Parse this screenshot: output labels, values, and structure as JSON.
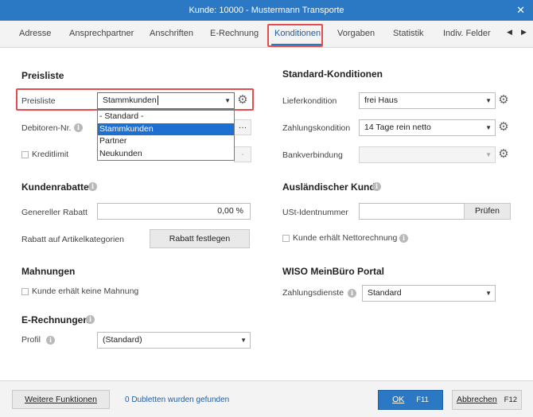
{
  "window": {
    "title": "Kunde: 10000 - Mustermann Transporte",
    "close": "✕"
  },
  "tabs": [
    {
      "label": "Adresse"
    },
    {
      "label": "Ansprechpartner"
    },
    {
      "label": "Anschriften"
    },
    {
      "label": "E-Rechnung"
    },
    {
      "label": "Konditionen"
    },
    {
      "label": "Vorgaben"
    },
    {
      "label": "Statistik"
    },
    {
      "label": "Indiv. Felder"
    }
  ],
  "tab_nav": {
    "prev": "◀",
    "next": "▶"
  },
  "preisliste": {
    "section": "Preisliste",
    "label": "Preisliste",
    "value": "Stammkunden",
    "options": [
      "- Standard -",
      "Stammkunden",
      "Partner",
      "Neukunden"
    ],
    "debitor_label": "Debitoren-Nr.",
    "debitor_button": "···",
    "kreditlimit_label": "Kreditlimit",
    "kreditlimit_button": "-"
  },
  "kundenrabatte": {
    "section": "Kundenrabatte",
    "generell_label": "Genereller Rabatt",
    "generell_value": "0,00 %",
    "kategorien_label": "Rabatt auf Artikelkategorien",
    "kategorien_button": "Rabatt festlegen"
  },
  "mahnungen": {
    "section": "Mahnungen",
    "checkbox_label": "Kunde erhält keine Mahnung"
  },
  "erechnungen": {
    "section": "E-Rechnungen",
    "profil_label": "Profil",
    "profil_value": "(Standard)"
  },
  "standard": {
    "section": "Standard-Konditionen",
    "liefer_label": "Lieferkondition",
    "liefer_value": "frei Haus",
    "zahlung_label": "Zahlungskondition",
    "zahlung_value": "14 Tage rein netto",
    "bank_label": "Bankverbindung",
    "bank_value": ""
  },
  "ausland": {
    "section": "Ausländischer Kunde",
    "ust_label": "USt-Identnummer",
    "ust_value": "",
    "pruefen_button": "Prüfen",
    "netto_label": "Kunde erhält Nettorechnung"
  },
  "portal": {
    "section": "WISO MeinBüro Portal",
    "dienste_label": "Zahlungsdienste",
    "dienste_value": "Standard"
  },
  "footer": {
    "weitere_button": "Weitere Funktionen",
    "dubletten_text": "0 Dubletten wurden gefunden",
    "ok_label": "OK",
    "ok_key": "F11",
    "cancel_label": "Abbrechen",
    "cancel_key": "F12"
  },
  "icons": {
    "caret": "▼",
    "gear": "⚙",
    "info": "i"
  },
  "colors": {
    "accent": "#2b78c4",
    "highlight": "#e84b4b",
    "selection": "#1e70d0"
  }
}
